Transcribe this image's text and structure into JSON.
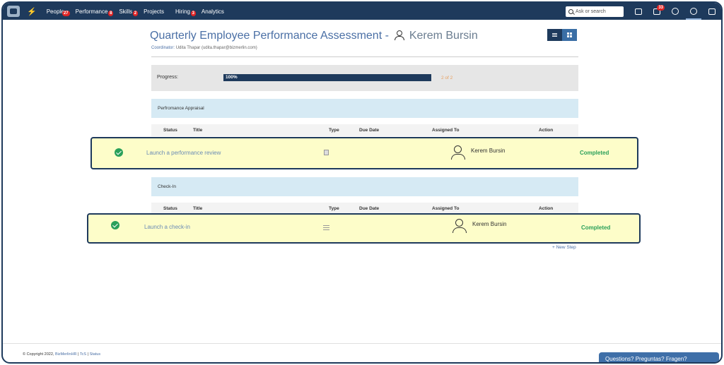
{
  "nav": {
    "items": [
      {
        "label": "People",
        "badge": "27"
      },
      {
        "label": "Performance",
        "badge": "8"
      },
      {
        "label": "Skills",
        "badge": "2"
      },
      {
        "label": "Projects",
        "badge": ""
      },
      {
        "label": "Hiring",
        "badge": "3"
      },
      {
        "label": "Analytics",
        "badge": ""
      }
    ],
    "search_placeholder": "Ask or search",
    "mail_badge": "33",
    "icons": [
      "graduation-cap-icon",
      "mail-icon",
      "help-icon",
      "gear-icon",
      "envelope-icon"
    ]
  },
  "header": {
    "title": "Quarterly Employee Performance Assessment -",
    "employee": "Kerem Bursin",
    "coordinator_label": "Coordinator:",
    "coordinator_value": "Udita Thapar (udita.thapar@bizmerlin.com)"
  },
  "progress": {
    "label": "Progress:",
    "percent_text": "100%",
    "fraction": 1.0,
    "count": "2 of 2"
  },
  "columns": {
    "status": "Status",
    "title": "Title",
    "type": "Type",
    "due_date": "Due Date",
    "assigned_to": "Assigned To",
    "action": "Action"
  },
  "sections": [
    {
      "name": "Perfromance Appraisal",
      "task": {
        "title": "Launch a performance review",
        "type_icon": "document-icon",
        "assignee": "Kerem Bursin",
        "status": "Completed"
      }
    },
    {
      "name": "Check-In",
      "task": {
        "title": "Launch a check-in",
        "type_icon": "checklist-icon",
        "assignee": "Kerem Bursin",
        "status": "Completed"
      }
    }
  ],
  "new_step": "+ New Step",
  "footer": {
    "copyright": "© Copyright 2022,",
    "brand": "BizMerlinHR",
    "sep": "|",
    "tcs": "TcS",
    "status": "Status"
  },
  "help_button": "Questions? Preguntas? Fragen?"
}
